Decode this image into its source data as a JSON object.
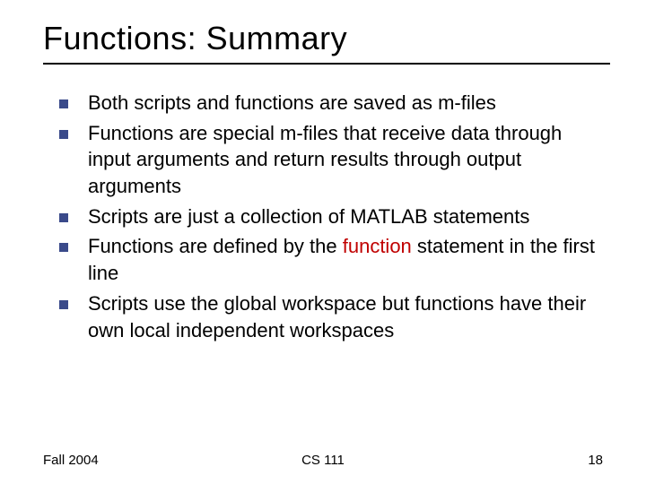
{
  "title": "Functions: Summary",
  "bullets": [
    {
      "text": "Both scripts and functions are saved as m-files"
    },
    {
      "text": "Functions are special m-files that receive data through input arguments and return results through output arguments"
    },
    {
      "text": "Scripts are just a collection of MATLAB statements"
    },
    {
      "pre": "Functions are defined by the ",
      "hl": "function",
      "post": " statement in the first line"
    },
    {
      "text": "Scripts use the global workspace but functions have their own local independent workspaces"
    }
  ],
  "footer": {
    "left": "Fall 2004",
    "center": "CS 111",
    "right": "18"
  }
}
